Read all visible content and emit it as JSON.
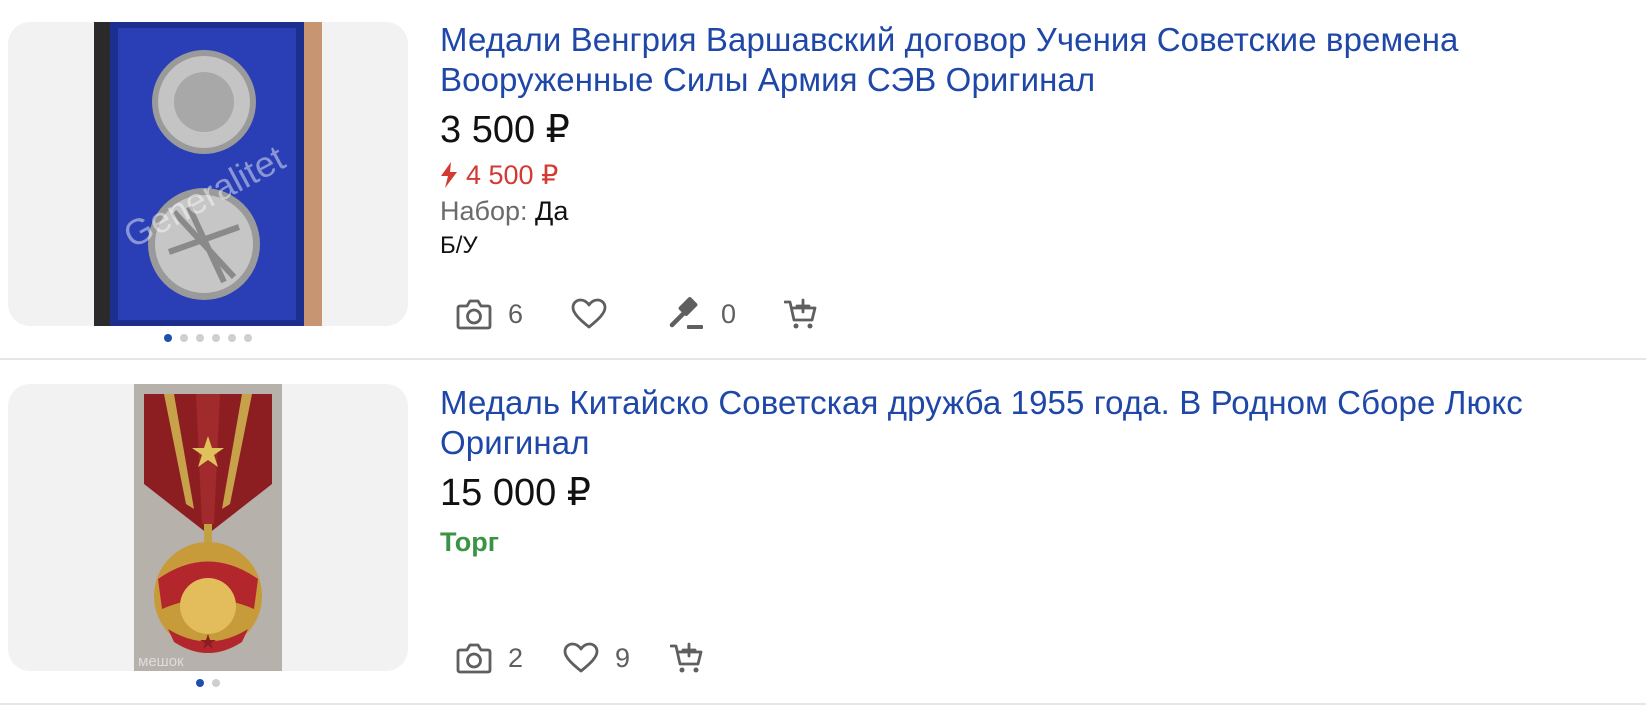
{
  "listings": [
    {
      "title": "Медали Венгрия Варшавский договор Учения Советские времена Вооруженные Силы Армия СЭВ Оригинал",
      "price": "3 500 ₽",
      "old_price": "4 500 ₽",
      "attribute": {
        "name": "Набор:",
        "value": "Да"
      },
      "condition": "Б/У",
      "photo_count": "6",
      "bid_count": "0",
      "gallery": {
        "total": 6,
        "active": 1
      },
      "photo_watermark": "Generalitet"
    },
    {
      "title": "Медаль Китайско Советская дружба 1955 года. В Родном Сборе Люкс Оригинал",
      "price": "15 000 ₽",
      "bargain_label": "Торг",
      "photo_count": "2",
      "favorite_count": "9",
      "gallery": {
        "total": 2,
        "active": 1
      },
      "photo_watermark": "мешок"
    }
  ],
  "icons": [
    "camera-icon",
    "heart-icon",
    "gavel-icon",
    "add-to-cart-icon",
    "lightning-icon"
  ],
  "colors": {
    "title_link": "#1e47a8",
    "old_price": "#d43a32",
    "bargain": "#3b9443",
    "dot_active": "#1f4fb0",
    "dot_inactive": "#cfcfcf",
    "photo_bg": "#f2f2f2"
  }
}
